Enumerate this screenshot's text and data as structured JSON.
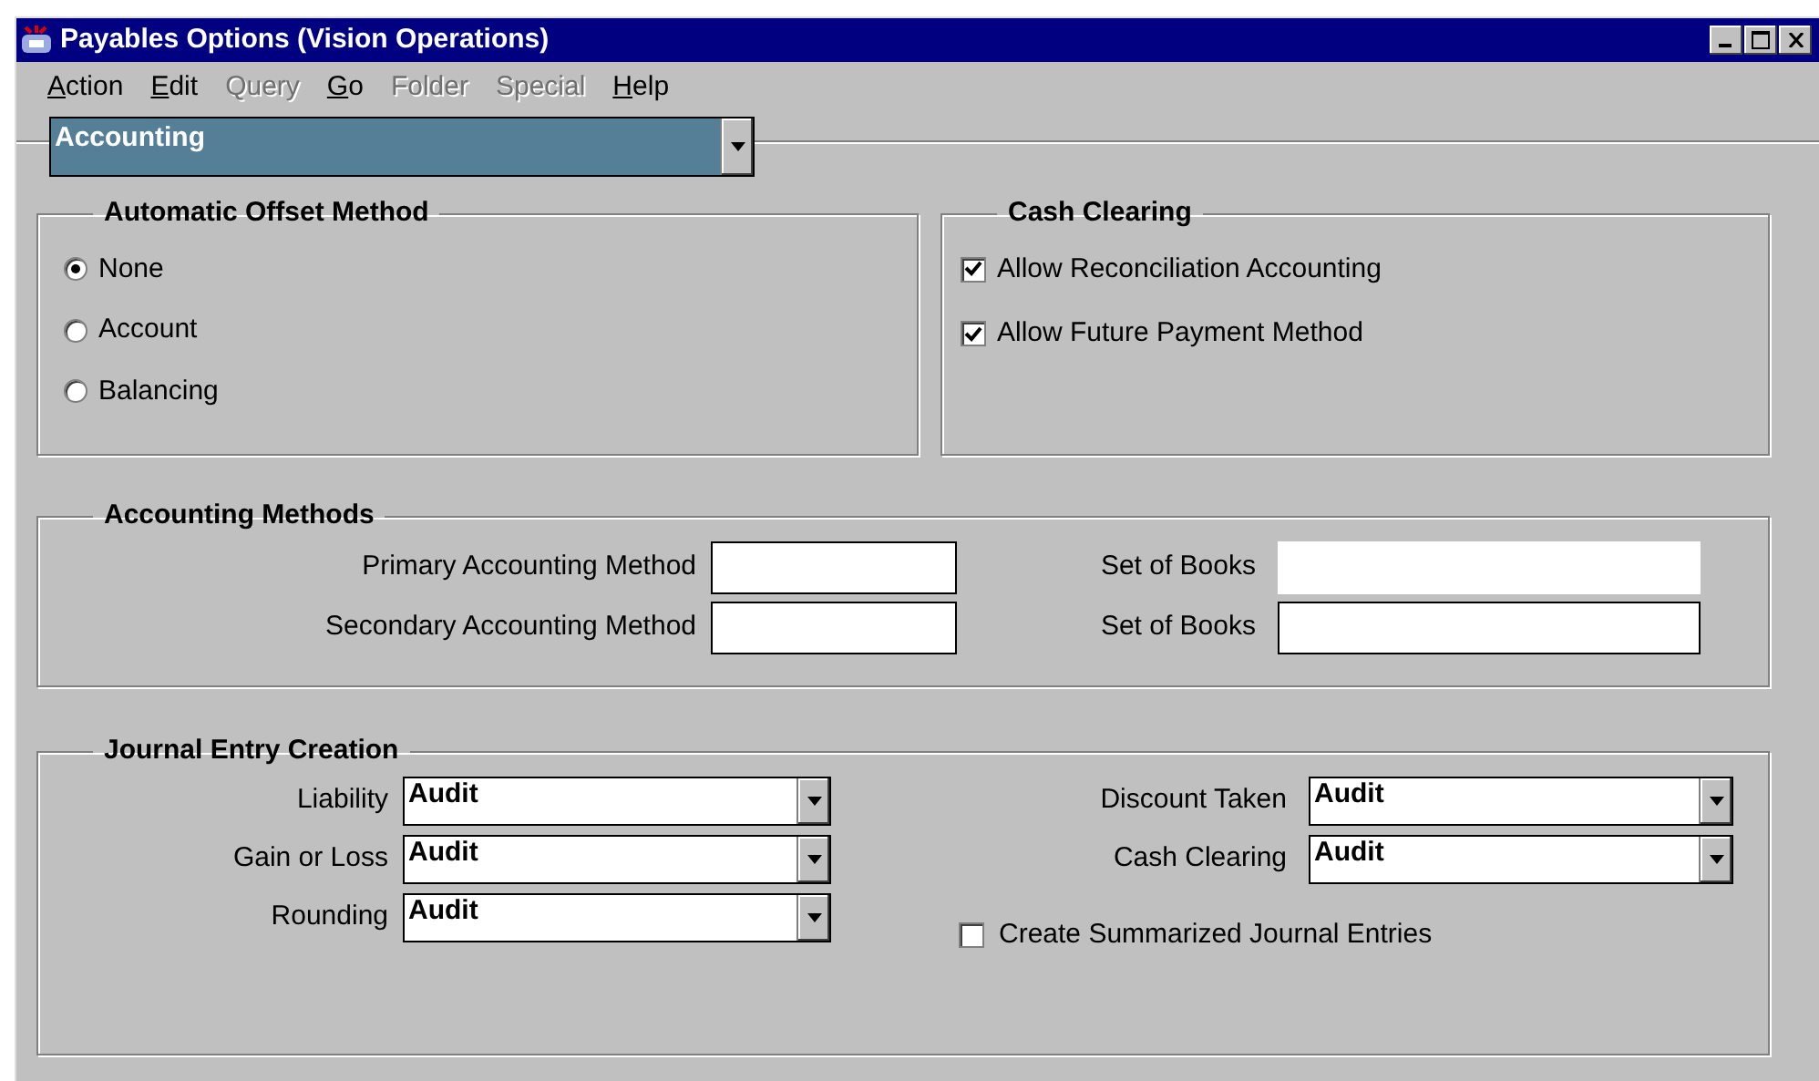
{
  "window": {
    "title": "Payables Options (Vision Operations)"
  },
  "menu": [
    {
      "label": "Action",
      "underline_first": true,
      "disabled": false
    },
    {
      "label": "Edit",
      "underline_first": true,
      "disabled": false
    },
    {
      "label": "Query",
      "underline_first": false,
      "disabled": true
    },
    {
      "label": "Go",
      "underline_first": true,
      "disabled": false
    },
    {
      "label": "Folder",
      "underline_first": false,
      "disabled": true
    },
    {
      "label": "Special",
      "underline_first": false,
      "disabled": true
    },
    {
      "label": "Help",
      "underline_first": true,
      "disabled": false
    }
  ],
  "region_selector": {
    "value": "Accounting"
  },
  "automatic_offset_method": {
    "title": "Automatic Offset Method",
    "options": [
      {
        "label": "None",
        "selected": true
      },
      {
        "label": "Account",
        "selected": false
      },
      {
        "label": "Balancing",
        "selected": false
      }
    ]
  },
  "cash_clearing": {
    "title": "Cash Clearing",
    "options": [
      {
        "label": "Allow Reconciliation Accounting",
        "checked": true
      },
      {
        "label": "Allow Future Payment Method",
        "checked": true
      }
    ]
  },
  "accounting_methods": {
    "title": "Accounting Methods",
    "rows": [
      {
        "label": "Primary Accounting Method",
        "books_label": "Set of Books",
        "books_disabled": true
      },
      {
        "label": "Secondary Accounting Method",
        "books_label": "Set of Books",
        "books_disabled": false
      }
    ]
  },
  "journal_entry_creation": {
    "title": "Journal Entry Creation",
    "left": [
      {
        "label": "Liability",
        "value": "Audit"
      },
      {
        "label": "Gain or Loss",
        "value": "Audit"
      },
      {
        "label": "Rounding",
        "value": "Audit"
      }
    ],
    "right": [
      {
        "label": "Discount Taken",
        "value": "Audit"
      },
      {
        "label": "Cash Clearing",
        "value": "Audit"
      }
    ],
    "summarize": {
      "label": "Create Summarized Journal Entries",
      "checked": false
    }
  }
}
